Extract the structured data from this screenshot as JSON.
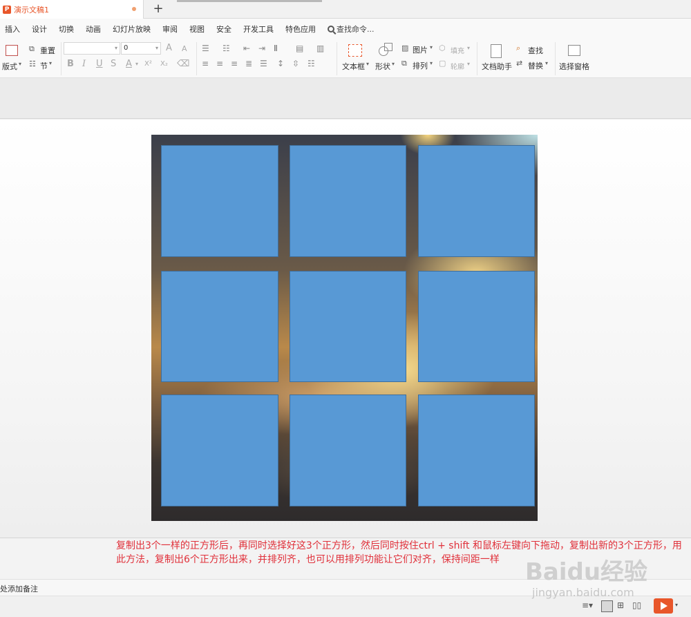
{
  "tab": {
    "app_icon": "P",
    "title": "演示文稿1",
    "new_tab": "+"
  },
  "menu": [
    "插入",
    "设计",
    "切换",
    "动画",
    "幻灯片放映",
    "审阅",
    "视图",
    "安全",
    "开发工具",
    "特色应用"
  ],
  "search": {
    "label": "查找命令..."
  },
  "ribbon": {
    "layout": "版式",
    "reset": "重置",
    "section": "节",
    "font_name": "",
    "font_size": "0",
    "textbox": "文本框",
    "shape": "形状",
    "picture": "图片",
    "fill": "填充",
    "arrange": "排列",
    "outline": "轮廓",
    "doc_assistant": "文档助手",
    "find": "查找",
    "replace": "替换",
    "selection_pane": "选择窗格",
    "bold": "B",
    "italic": "I",
    "underline": "U",
    "strike": "S",
    "font_color": "A",
    "grow_font": "A",
    "shrink_font": "A",
    "superscript": "X²",
    "subscript": "X₂"
  },
  "caption": "复制出3个一样的正方形后，再同时选择好这3个正方形，然后同时按住ctrl + shift 和鼠标左键向下拖动，复制出新的3个正方形，用此方法，复制出6个正方形出来，并排列齐，也可以用排列功能让它们对齐，保持间距一样",
  "notes_placeholder": "处添加备注",
  "watermark": {
    "brand": "Baidu经验",
    "url": "jingyan.baidu.com"
  },
  "colors": {
    "accent": "#e8562a",
    "square_fill": "#5899d5",
    "caption": "#e0303a"
  }
}
